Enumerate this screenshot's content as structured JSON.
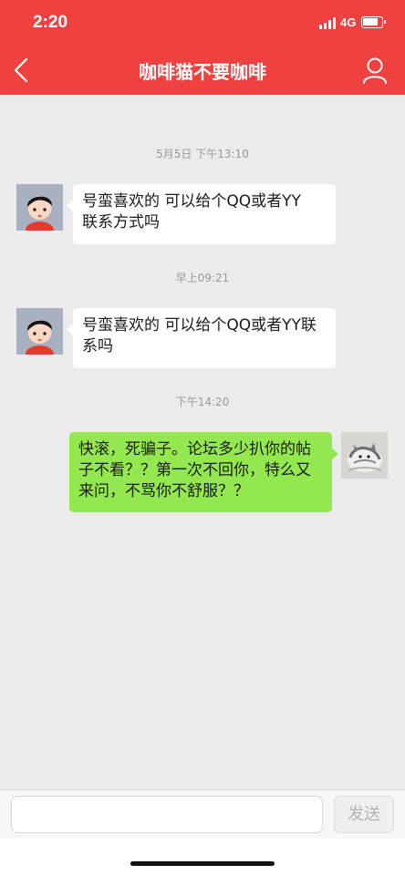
{
  "status_bar": {
    "time": "2:20",
    "network": "4G"
  },
  "header": {
    "title": "咖啡猫不要咖啡",
    "accent_color": "#ef4240"
  },
  "messages": [
    {
      "timestamp": "5月5日 下午13:10",
      "direction": "incoming",
      "text_line1": "号蛮喜欢的 可以给个QQ或者YY",
      "text_line2": "联系方式吗"
    },
    {
      "timestamp": "早上09:21",
      "direction": "incoming",
      "text_line1": "号蛮喜欢的 可以给个QQ或者YY联",
      "text_line2": "系吗"
    },
    {
      "timestamp": "下午14:20",
      "direction": "outgoing",
      "text_line1": "快滚，死骗子。论坛多少扒你的帖",
      "text_line2": "子不看？？第一次不回你，特么又",
      "text_line3": "来问，不骂你不舒服？？"
    }
  ],
  "composer": {
    "placeholder": "",
    "send_label": "发送"
  },
  "icons": {
    "back": "chevron-left-icon",
    "profile": "person-icon",
    "signal": "signal-icon",
    "battery": "battery-icon"
  },
  "colors": {
    "incoming_bubble": "#ffffff",
    "outgoing_bubble": "#93e74f",
    "background": "#ebebeb"
  }
}
